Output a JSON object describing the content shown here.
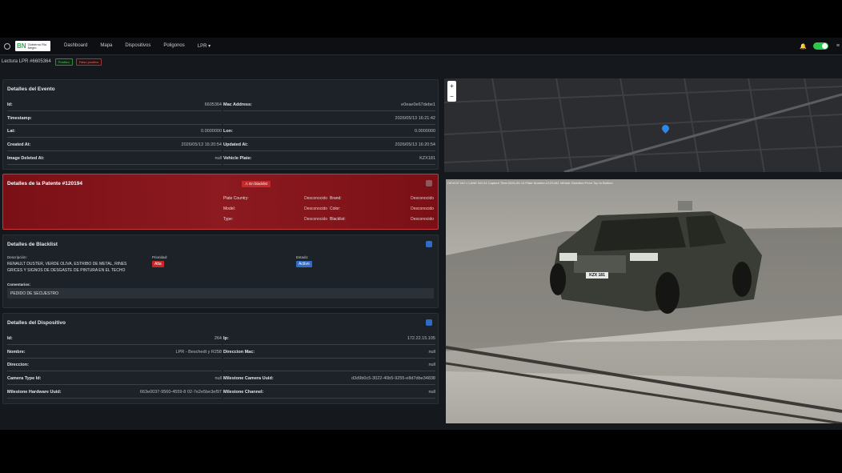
{
  "nav": {
    "logo": {
      "short": "BN",
      "text": "Gobierno Rio Negro"
    },
    "links": [
      "Dashboard",
      "Mapa",
      "Dispositivos",
      "Poligonos",
      "LPR ▾"
    ]
  },
  "subheader": {
    "title": "Lectura LPR #6605364",
    "badge_green": "Positivo",
    "badge_red": "Falso positivo"
  },
  "evento": {
    "title": "Detalles del Evento",
    "rows": [
      {
        "k1": "Id:",
        "v1": "6605364",
        "k2": "Mac Address:",
        "v2": "e0eae0e67debe1"
      },
      {
        "k1": "Timestamp:",
        "v1": "",
        "k2": "",
        "v2": "2026/05/13 16:21:42"
      },
      {
        "k1": "Lat:",
        "v1": "0.0000000",
        "k2": "Lon:",
        "v2": "0.0000000"
      },
      {
        "k1": "Created At:",
        "v1": "2026/05/13 16:20:54",
        "k2": "Updated At:",
        "v2": "2026/05/13 16:20:54"
      },
      {
        "k1": "Image Deleted At:",
        "v1": "null",
        "k2": "Vehicle Plate:",
        "v2": "KZX181"
      }
    ]
  },
  "patente": {
    "title": "Detalles de la Patente",
    "id": "#120194",
    "badge": "⚠ En blacklist",
    "rows": [
      {
        "k1": "Plate Country:",
        "v1": "Desconocido",
        "k2": "Brand:",
        "v2": "Desconocido"
      },
      {
        "k1": "Model:",
        "v1": "Desconocido",
        "k2": "Color:",
        "v2": "Desconocido"
      },
      {
        "k1": "Type:",
        "v1": "Desconocido",
        "k2": "Blacklist:",
        "v2": "Desconocido"
      }
    ]
  },
  "blacklist": {
    "title": "Detalles de Blacklist",
    "desc_label": "Descripción:",
    "desc_1": "RENAULT DUSTER, VERDE OLIVA, ESTRIBO DE METAL, RINES",
    "desc_2": "GRICES Y SIGNOS DE DESGASTE DE PINTURA EN EL TECHO",
    "prio_label": "Prioridad:",
    "prio": "Alta",
    "estado_label": "Estado:",
    "estado": "Activo",
    "comments_label": "Comentarios:",
    "comments": "PEDIDO DE SECUESTRO",
    "colors": {
      "prio": "#c62828",
      "estado": "#2f6bc7"
    }
  },
  "dispositivo": {
    "title": "Detalles del Dispositivo",
    "rows": [
      {
        "k1": "Id:",
        "v1": "264",
        "k2": "Ip:",
        "v2": "172.22.15.105"
      },
      {
        "k1": "Nombre:",
        "v1": "LPR - Beschedt y R258",
        "k2": "Direccion Mac:",
        "v2": "null"
      },
      {
        "k1": "Direccion:",
        "v1": "",
        "k2": "",
        "v2": "null"
      },
      {
        "k1": "Camera Type Id:",
        "v1": "null",
        "k2": "Milestone Camera Uuid:",
        "v2": "d3d9b0c5-3022-40b5-9255-e8d7dbe34838"
      },
      {
        "k1": "Milestone Hardware Uuid:",
        "v1": "663e0037-9560-4559-8 02-7e2e5be3ef97",
        "k2": "Milestone Channel:",
        "v2": "null"
      }
    ]
  },
  "map": {
    "zoom_in": "+",
    "zoom_out": "−"
  },
  "photo": {
    "overlay": "DEVICE NO.1  LANE NO.01  Capture Time:2026-05-13  Plate Number:LKZX181  Vehicle Direction:From Top to Bottom",
    "plate": "KZX 181"
  }
}
